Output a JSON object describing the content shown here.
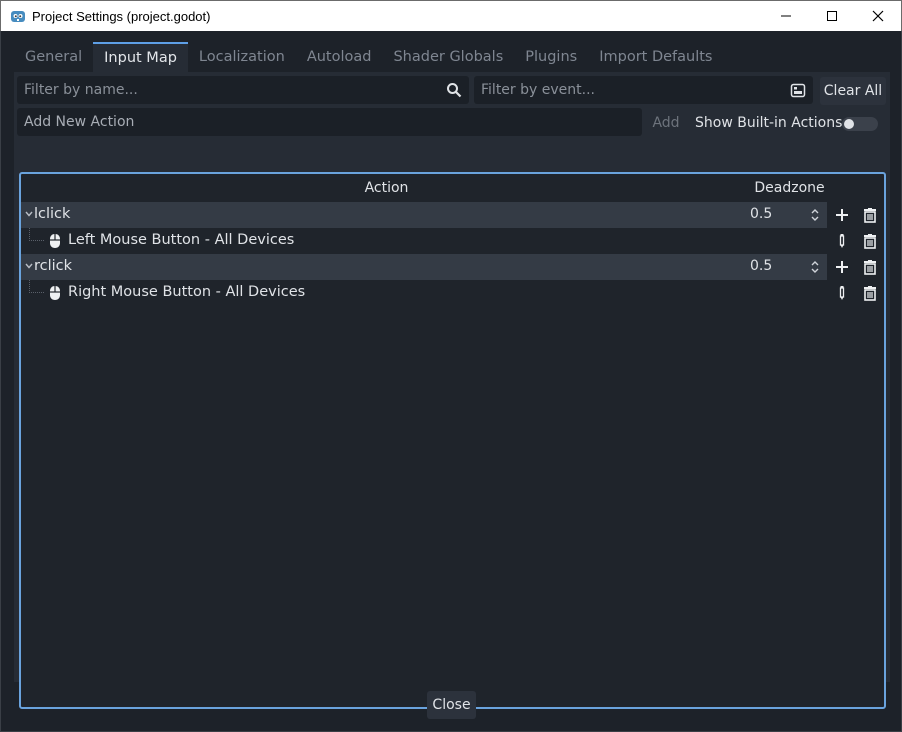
{
  "window": {
    "title": "Project Settings (project.godot)"
  },
  "tabs": [
    {
      "label": "General"
    },
    {
      "label": "Input Map"
    },
    {
      "label": "Localization"
    },
    {
      "label": "Autoload"
    },
    {
      "label": "Shader Globals"
    },
    {
      "label": "Plugins"
    },
    {
      "label": "Import Defaults"
    }
  ],
  "filters": {
    "name_placeholder": "Filter by name...",
    "event_placeholder": "Filter by event...",
    "clear_all_label": "Clear All"
  },
  "add_action": {
    "placeholder": "Add New Action",
    "add_label": "Add",
    "show_builtin_label": "Show Built-in Actions",
    "show_builtin_on": false
  },
  "tree": {
    "header_action": "Action",
    "header_deadzone": "Deadzone",
    "actions": [
      {
        "name": "lclick",
        "deadzone": "0.5",
        "event": "Left Mouse Button - All Devices"
      },
      {
        "name": "rclick",
        "deadzone": "0.5",
        "event": "Right Mouse Button - All Devices"
      }
    ]
  },
  "footer": {
    "close_label": "Close"
  },
  "colors": {
    "accent": "#6aa3dd",
    "panel": "#262c35",
    "background": "#1d2229"
  }
}
